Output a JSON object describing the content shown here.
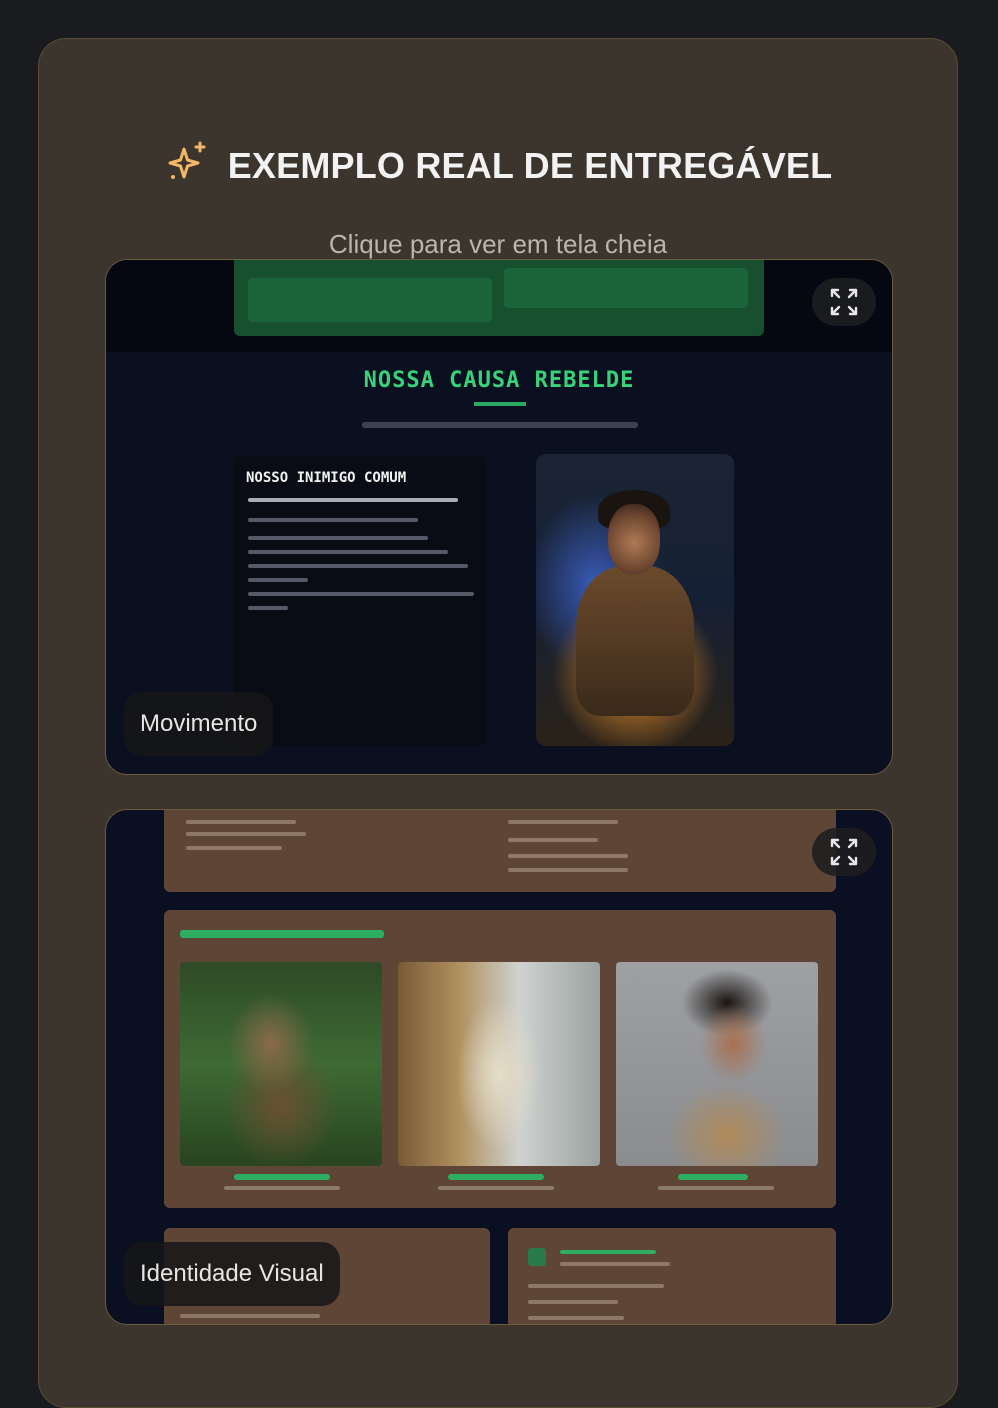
{
  "header": {
    "icon": "sparkles-icon",
    "title": "EXEMPLO REAL DE ENTREGÁVEL",
    "subtitle": "Clique para ver em tela cheia",
    "accent": "#f3b765"
  },
  "cards": [
    {
      "label": "Movimento",
      "expand_icon": "expand-icon",
      "preview": {
        "heading": "NOSSA CAUSA REBELDE",
        "box_title": "NOSSO INIMIGO COMUM"
      }
    },
    {
      "label": "Identidade Visual",
      "expand_icon": "expand-icon"
    }
  ]
}
